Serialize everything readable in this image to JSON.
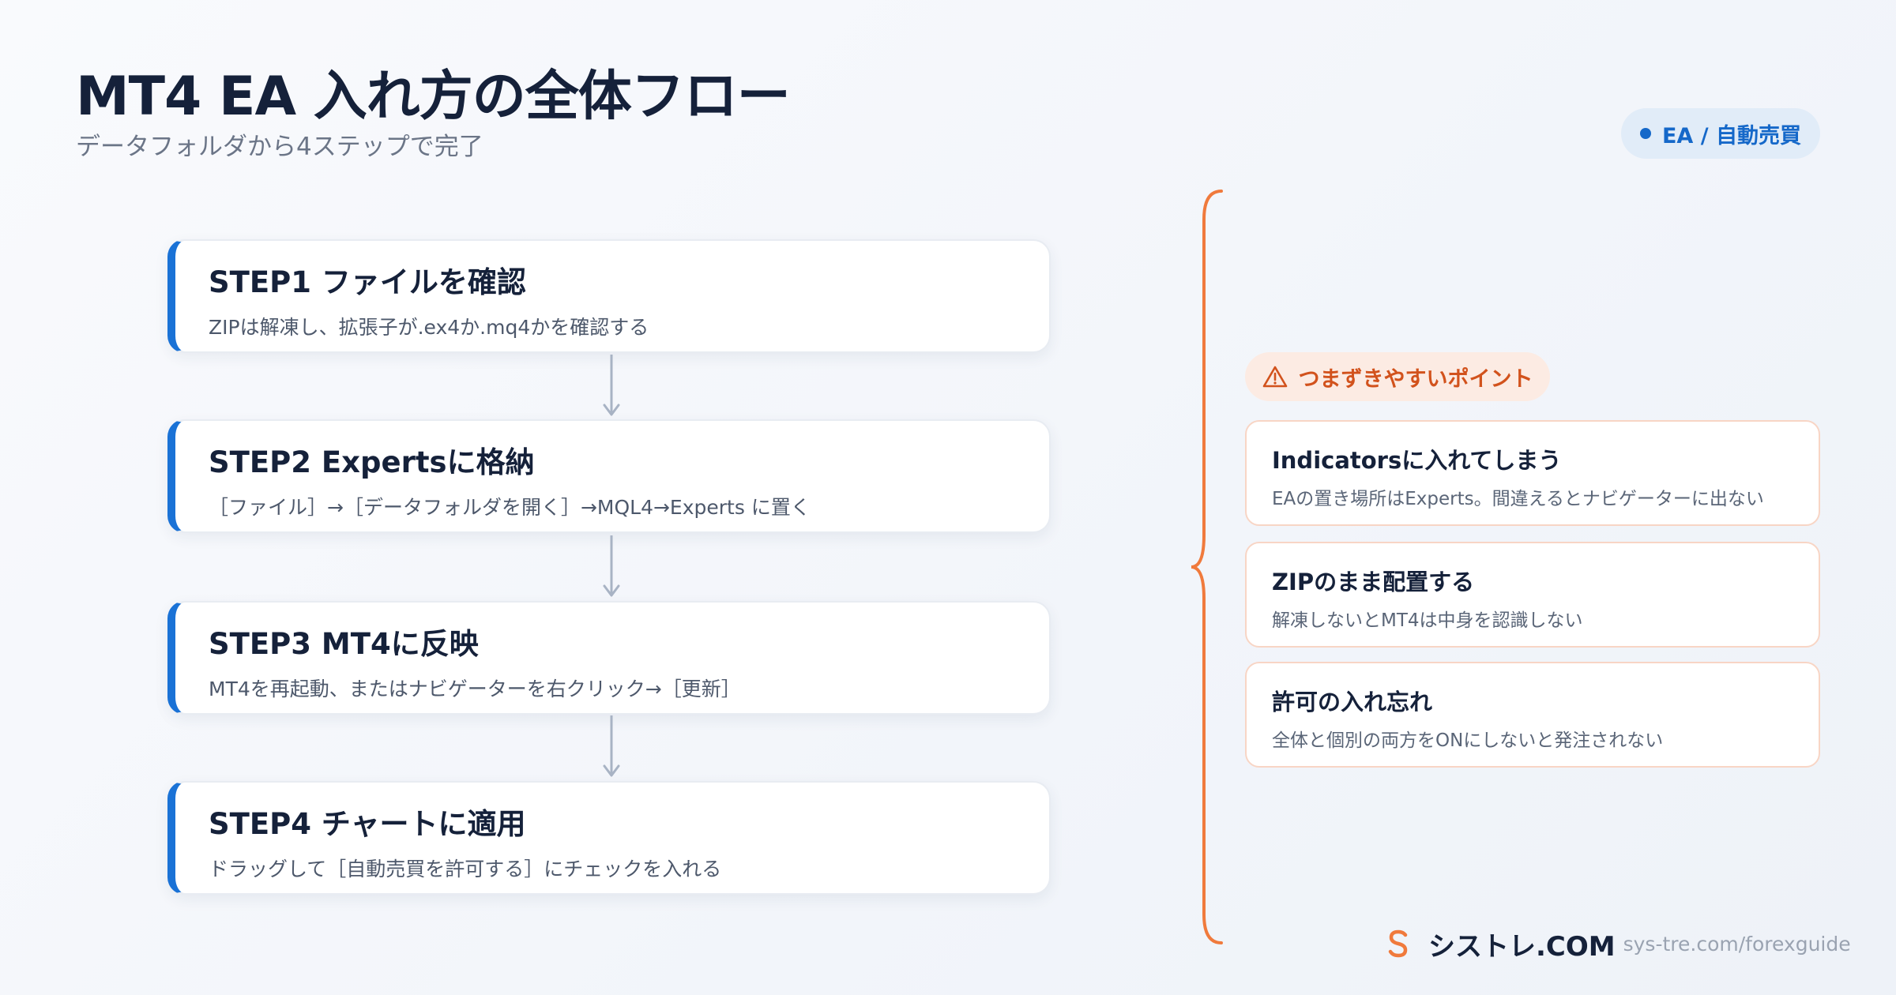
{
  "header": {
    "title": "MT4 EA 入れ方の全体フロー",
    "subtitle": "データフォルダから4ステップで完了",
    "badge": "EA / 自動売買"
  },
  "steps": [
    {
      "title": "STEP1 ファイルを確認",
      "desc": "ZIPは解凍し、拡張子が.ex4か.mq4かを確認する"
    },
    {
      "title": "STEP2 Expertsに格納",
      "desc": "［ファイル］→［データフォルダを開く］→MQL4→Experts に置く"
    },
    {
      "title": "STEP3 MT4に反映",
      "desc": "MT4を再起動、またはナビゲーターを右クリック→［更新］"
    },
    {
      "title": "STEP4 チャートに適用",
      "desc": "ドラッグして［自動売買を許可する］にチェックを入れる"
    }
  ],
  "pitfalls": {
    "heading": "つまずきやすいポイント",
    "items": [
      {
        "title": "Indicatorsに入れてしまう",
        "desc": "EAの置き場所はExperts。間違えるとナビゲーターに出ない"
      },
      {
        "title": "ZIPのまま配置する",
        "desc": "解凍しないとMT4は中身を認識しない"
      },
      {
        "title": "許可の入れ忘れ",
        "desc": "全体と個別の両方をONにしないと発注されない"
      }
    ]
  },
  "footer": {
    "brand": "シストレ.COM",
    "url": "sys-tre.com/forexguide"
  },
  "colors": {
    "accent_blue": "#1a72d6",
    "accent_orange": "#f07a3c",
    "text_dark": "#15213a"
  }
}
